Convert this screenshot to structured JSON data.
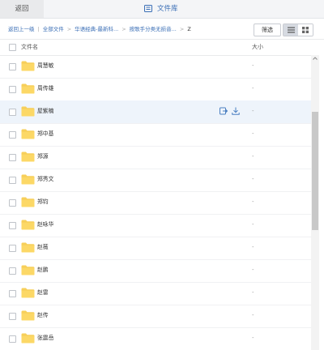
{
  "topbar": {
    "back_label": "返回",
    "title": "文件库"
  },
  "breadcrumb": {
    "back_up": "返回上一级",
    "items": [
      "全部文件",
      "华语经典-最新科...",
      "按歌手分类无损音..."
    ],
    "current": "Z"
  },
  "toolbar": {
    "filter_label": "筛选"
  },
  "table": {
    "col_name": "文件名",
    "col_size": "大小"
  },
  "rows": [
    {
      "name": "周慧敏",
      "size": "-"
    },
    {
      "name": "周传雄",
      "size": "-"
    },
    {
      "name": "屋紫楠",
      "size": "-"
    },
    {
      "name": "郑中基",
      "size": "-"
    },
    {
      "name": "郑源",
      "size": "-"
    },
    {
      "name": "郑秀文",
      "size": "-"
    },
    {
      "name": "郑钧",
      "size": "-"
    },
    {
      "name": "赵咏华",
      "size": "-"
    },
    {
      "name": "赵薇",
      "size": "-"
    },
    {
      "name": "赵鹏",
      "size": "-"
    },
    {
      "name": "赵雷",
      "size": "-"
    },
    {
      "name": "赵传",
      "size": "-"
    },
    {
      "name": "张震岳",
      "size": "-"
    }
  ],
  "hover_row": 2,
  "colors": {
    "accent": "#3b6fb6",
    "folder": "#f7cf5a",
    "hover": "#eef4fb"
  },
  "icons": {
    "title": "library-icon",
    "folder": "folder-icon",
    "row_actions": [
      "share-icon",
      "download-icon"
    ]
  }
}
